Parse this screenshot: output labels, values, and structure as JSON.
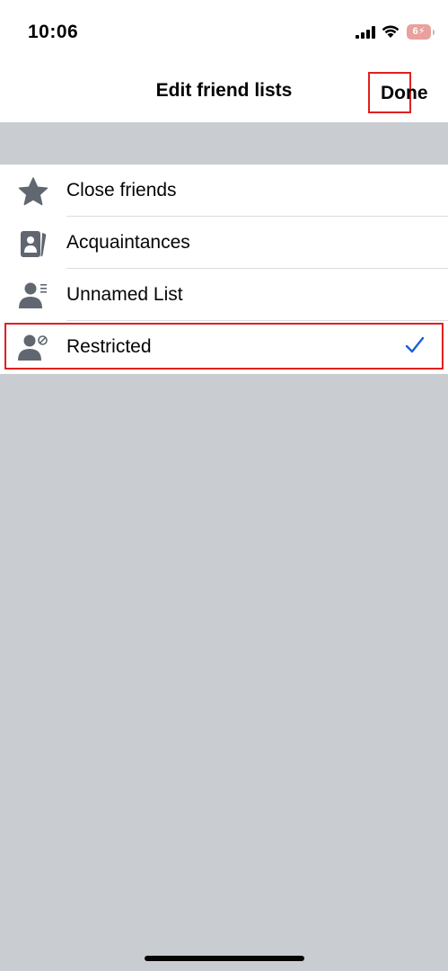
{
  "status_bar": {
    "time": "10:06",
    "signal_icon": "cellular-signal-icon",
    "wifi_icon": "wifi-icon",
    "battery_label": "6"
  },
  "nav": {
    "title": "Edit friend lists",
    "done_label": "Done"
  },
  "lists": [
    {
      "label": "Close friends",
      "icon": "star-icon"
    },
    {
      "label": "Acquaintances",
      "icon": "acquaintances-icon"
    },
    {
      "label": "Unnamed List",
      "icon": "person-list-icon"
    },
    {
      "label": "Restricted",
      "icon": "person-restricted-icon",
      "selected": true
    }
  ],
  "colors": {
    "icon_gray": "#606770",
    "check_blue": "#1b5fe0",
    "highlight_red": "#e02020",
    "background_gray": "#c9ccd1"
  }
}
